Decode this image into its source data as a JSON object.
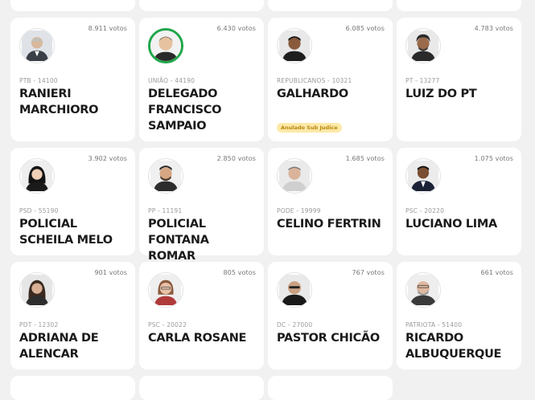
{
  "candidates": [
    {
      "votes": "8.911 votos",
      "party": "PTB - 14100",
      "name": "RANIERI MARCHIORO",
      "badge": ""
    },
    {
      "votes": "6.430 votos",
      "party": "UNIÃO - 44190",
      "name": "DELEGADO FRANCISCO SAMPAIO",
      "badge": ""
    },
    {
      "votes": "6.085 votos",
      "party": "REPUBLICANOS - 10321",
      "name": "GALHARDO",
      "badge": "Anulado Sub Judice"
    },
    {
      "votes": "4.783 votos",
      "party": "PT - 13277",
      "name": "LUIZ DO PT",
      "badge": ""
    },
    {
      "votes": "3.902 votos",
      "party": "PSD - 55190",
      "name": "POLICIAL SCHEILA MELO",
      "badge": ""
    },
    {
      "votes": "2.850 votos",
      "party": "PP - 11191",
      "name": "POLICIAL FONTANA ROMAR",
      "badge": ""
    },
    {
      "votes": "1.685 votos",
      "party": "PODE - 19999",
      "name": "CELINO FERTRIN",
      "badge": ""
    },
    {
      "votes": "1.075 votos",
      "party": "PSC - 20220",
      "name": "LUCIANO LIMA",
      "badge": ""
    },
    {
      "votes": "901 votos",
      "party": "PDT - 12302",
      "name": "ADRIANA DE ALENCAR",
      "badge": ""
    },
    {
      "votes": "805 votos",
      "party": "PSC - 20022",
      "name": "CARLA ROSANE",
      "badge": ""
    },
    {
      "votes": "767 votos",
      "party": "DC - 27000",
      "name": "PASTOR CHICÃO",
      "badge": ""
    },
    {
      "votes": "661 votos",
      "party": "PATRIOTA - 51400",
      "name": "RICARDO ALBUQUERQUE",
      "badge": ""
    }
  ],
  "icons": {
    "avatar": "candidate-photo-icon"
  },
  "colors": {
    "background": "#f1f1f1",
    "card": "#ffffff",
    "badge_bg": "#fde9a8",
    "badge_text": "#b8860b",
    "avatar_ring_green": "#1fa64a"
  }
}
